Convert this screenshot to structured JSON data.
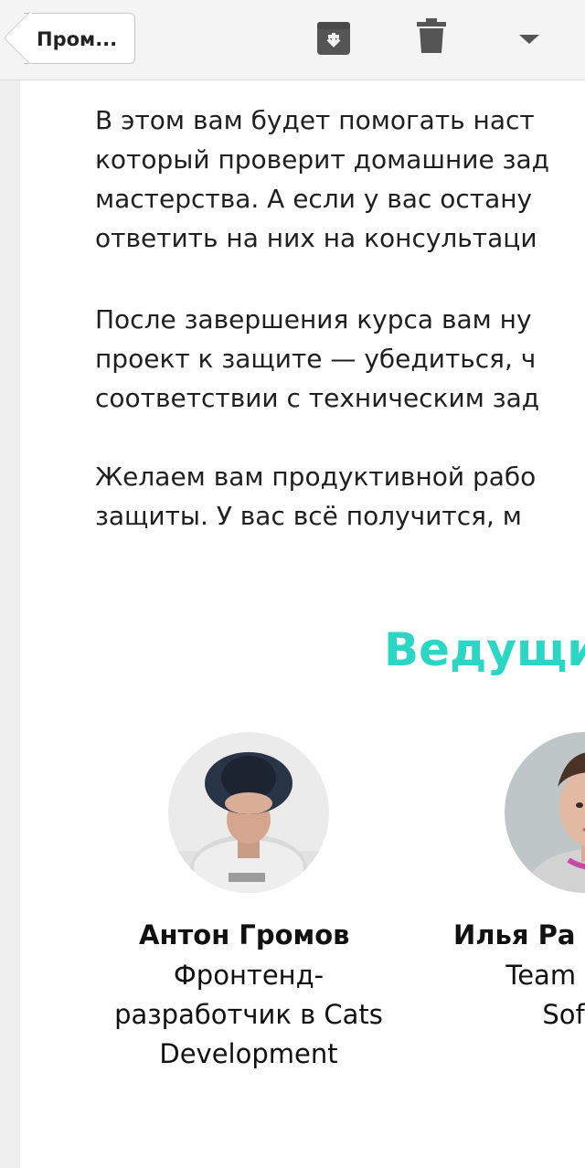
{
  "toolbar": {
    "back_label": "Пром...",
    "archive_icon": "archive-icon",
    "trash_icon": "trash-icon",
    "more_icon": "chevron-down-icon"
  },
  "body": {
    "paragraph1": [
      "В этом вам будет помогать наст",
      "который проверит домашние зад",
      "мастерства. А если у вас остану",
      "ответить на них на консультаци"
    ],
    "paragraph2": [
      "После завершения курса вам ну",
      "проект к защите — убедиться, ч",
      "соответствии с техническим зад"
    ],
    "paragraph3": [
      "Желаем вам продуктивной рабо",
      "защиты. У вас всё получится, м"
    ]
  },
  "hosts_section": {
    "title": "Ведущи",
    "accent_color": "#2bd6c4",
    "hosts": [
      {
        "name": "Антон Громов",
        "role_lines": [
          "Фронтенд-",
          "разработчик в Cats",
          "Development"
        ]
      },
      {
        "name": "Илья Ра",
        "role_lines": [
          "Team Lea",
          "Soft"
        ]
      }
    ]
  }
}
